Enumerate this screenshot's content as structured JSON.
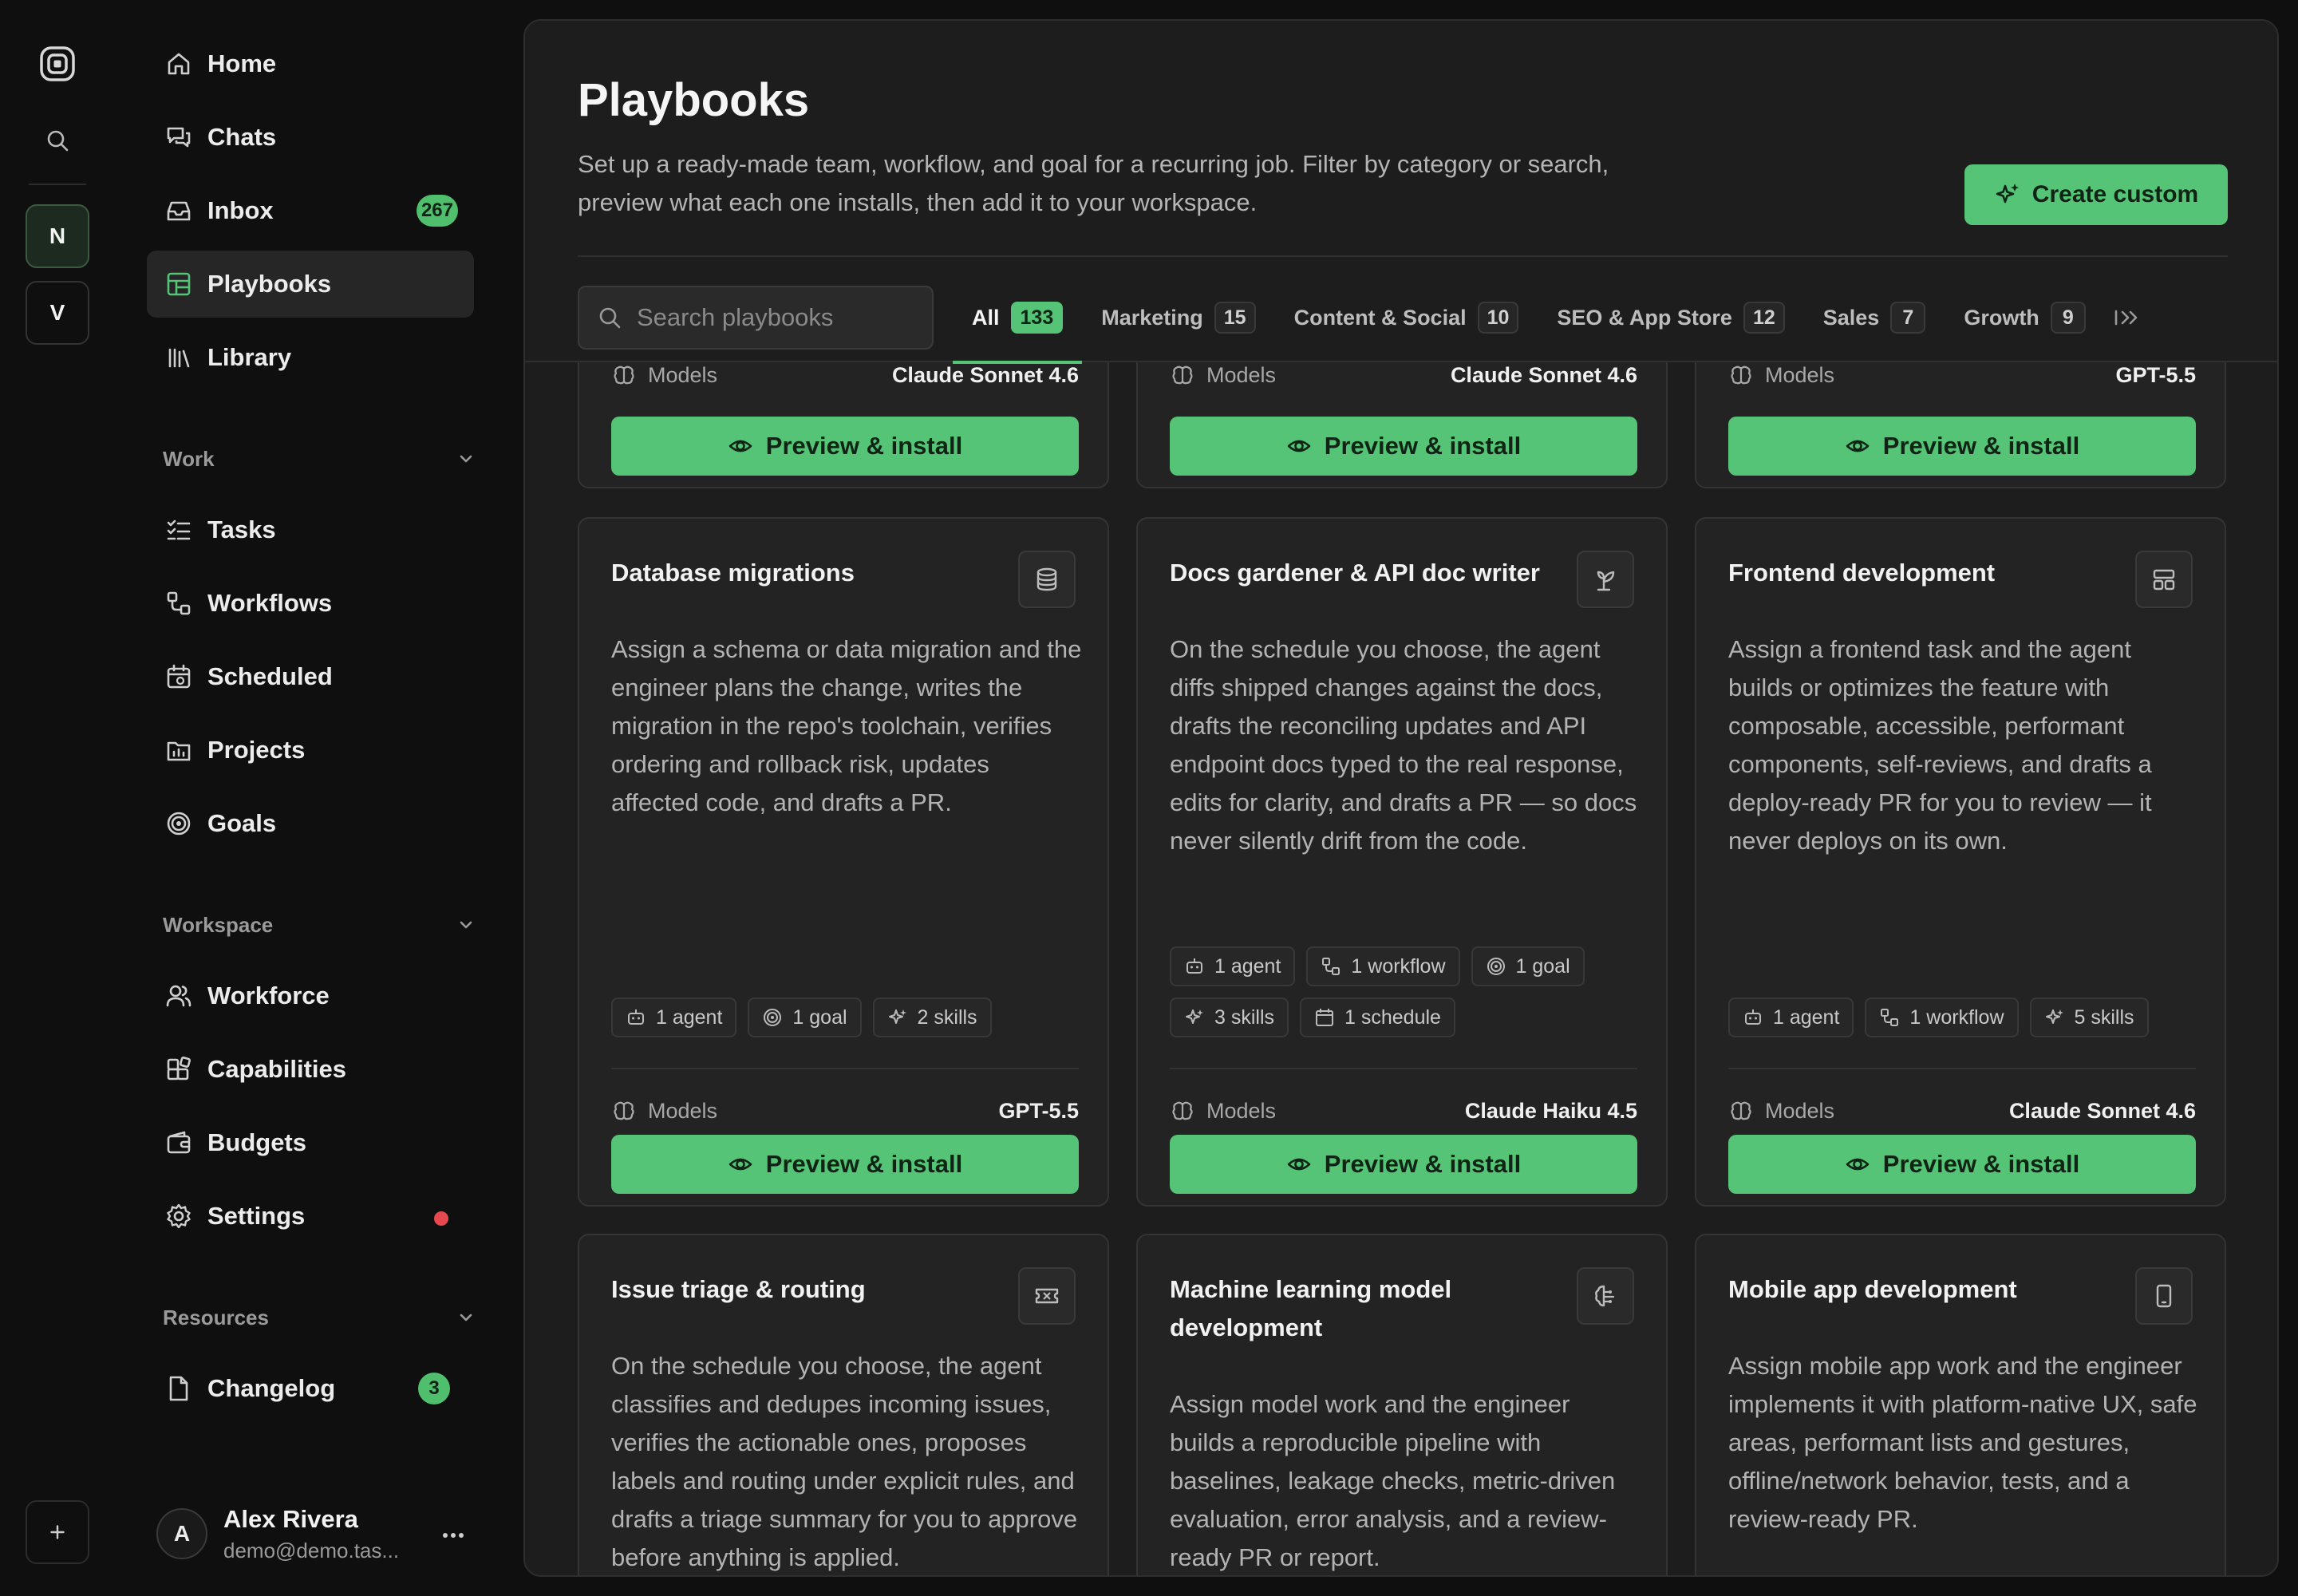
{
  "rail": {
    "workspaces": [
      "N",
      "V"
    ]
  },
  "nav": {
    "primary": [
      {
        "label": "Home",
        "icon": "home-icon"
      },
      {
        "label": "Chats",
        "icon": "chats-icon"
      },
      {
        "label": "Inbox",
        "icon": "inbox-icon",
        "badge": "267"
      },
      {
        "label": "Playbooks",
        "icon": "playbooks-icon",
        "active": true
      },
      {
        "label": "Library",
        "icon": "library-icon"
      }
    ],
    "work": {
      "title": "Work",
      "items": [
        {
          "label": "Tasks",
          "icon": "tasks-icon"
        },
        {
          "label": "Workflows",
          "icon": "workflows-icon"
        },
        {
          "label": "Scheduled",
          "icon": "calendar-icon"
        },
        {
          "label": "Projects",
          "icon": "projects-icon"
        },
        {
          "label": "Goals",
          "icon": "target-icon"
        }
      ]
    },
    "workspace": {
      "title": "Workspace",
      "items": [
        {
          "label": "Workforce",
          "icon": "users-icon"
        },
        {
          "label": "Capabilities",
          "icon": "capabilities-icon"
        },
        {
          "label": "Budgets",
          "icon": "wallet-icon"
        },
        {
          "label": "Settings",
          "icon": "gear-icon",
          "status": "alert"
        }
      ]
    },
    "resources": {
      "title": "Resources",
      "items": [
        {
          "label": "Changelog",
          "icon": "file-icon",
          "badge": "3"
        }
      ]
    }
  },
  "user": {
    "initial": "A",
    "name": "Alex Rivera",
    "email": "demo@demo.tas..."
  },
  "main": {
    "title": "Playbooks",
    "description": "Set up a ready-made team, workflow, and goal for a recurring job. Filter by category or search, preview what each one installs, then add it to your workspace.",
    "create_label": "Create custom",
    "search_placeholder": "Search playbooks",
    "tabs": [
      {
        "label": "All",
        "count": "133",
        "active": true
      },
      {
        "label": "Marketing",
        "count": "15"
      },
      {
        "label": "Content & Social",
        "count": "10"
      },
      {
        "label": "SEO & App Store",
        "count": "12"
      },
      {
        "label": "Sales",
        "count": "7"
      },
      {
        "label": "Growth",
        "count": "9"
      }
    ]
  },
  "labels": {
    "models": "Models",
    "install": "Preview & install"
  },
  "cards_partial": [
    {
      "model": "Claude Sonnet 4.6"
    },
    {
      "model": "Claude Sonnet 4.6"
    },
    {
      "model": "GPT-5.5"
    }
  ],
  "cards": [
    {
      "title": "Database migrations",
      "icon": "database-icon",
      "description": "Assign a schema or data migration and the engineer plans the change, writes the migration in the repo's toolchain, verifies ordering and rollback risk, updates affected code, and drafts a PR.",
      "chips": [
        {
          "label": "1 agent",
          "icon": "bot-icon"
        },
        {
          "label": "1 goal",
          "icon": "target-icon"
        },
        {
          "label": "2 skills",
          "icon": "sparkles-icon"
        }
      ],
      "model": "GPT-5.5"
    },
    {
      "title": "Docs gardener & API doc writer",
      "icon": "sprout-icon",
      "description": "On the schedule you choose, the agent diffs shipped changes against the docs, drafts the reconciling updates and API endpoint docs typed to the real response, edits for clarity, and drafts a PR — so docs never silently drift from the code.",
      "chips": [
        {
          "label": "1 agent",
          "icon": "bot-icon"
        },
        {
          "label": "1 workflow",
          "icon": "workflow-icon"
        },
        {
          "label": "1 goal",
          "icon": "target-icon"
        },
        {
          "label": "3 skills",
          "icon": "sparkles-icon"
        },
        {
          "label": "1 schedule",
          "icon": "calendar-icon"
        }
      ],
      "model": "Claude Haiku 4.5"
    },
    {
      "title": "Frontend development",
      "icon": "layout-icon",
      "description": "Assign a frontend task and the agent builds or optimizes the feature with composable, accessible, performant components, self-reviews, and drafts a deploy-ready PR for you to review — it never deploys on its own.",
      "chips": [
        {
          "label": "1 agent",
          "icon": "bot-icon"
        },
        {
          "label": "1 workflow",
          "icon": "workflow-icon"
        },
        {
          "label": "5 skills",
          "icon": "sparkles-icon"
        }
      ],
      "model": "Claude Sonnet 4.6"
    },
    {
      "title": "Issue triage & routing",
      "icon": "ticket-icon",
      "description": "On the schedule you choose, the agent classifies and dedupes incoming issues, verifies the actionable ones, proposes labels and routing under explicit rules, and drafts a triage summary for you to approve before anything is applied."
    },
    {
      "title": "Machine learning model development",
      "icon": "brain-icon",
      "description": "Assign model work and the engineer builds a reproducible pipeline with baselines, leakage checks, metric-driven evaluation, error analysis, and a review-ready PR or report."
    },
    {
      "title": "Mobile app development",
      "icon": "smartphone-icon",
      "description": "Assign mobile app work and the engineer implements it with platform-native UX, safe areas, performant lists and gestures, offline/network behavior, tests, and a review-ready PR."
    }
  ]
}
